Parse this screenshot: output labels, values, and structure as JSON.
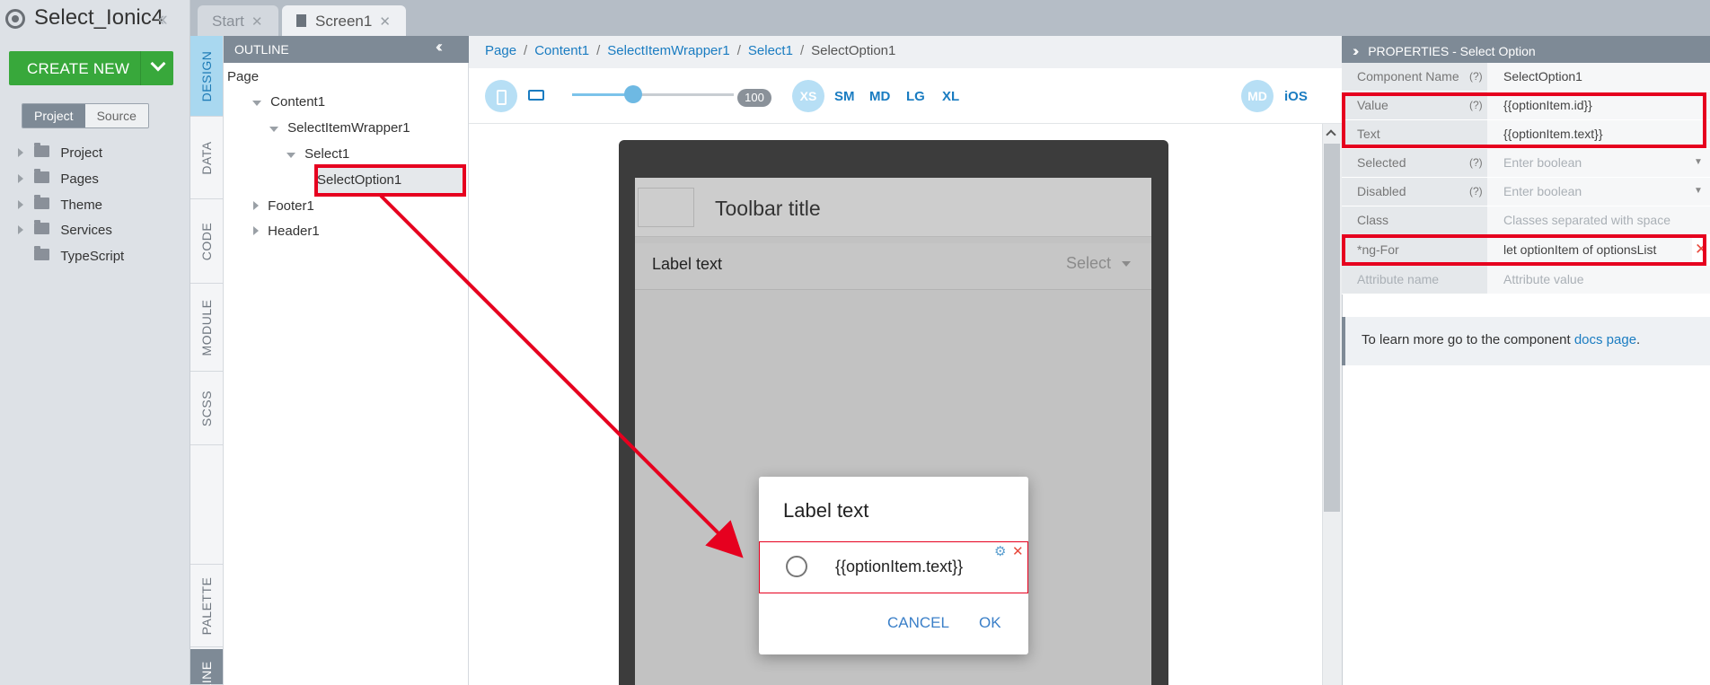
{
  "app": {
    "title": "Select_Ionic4",
    "create_new": "CREATE NEW",
    "toggle": [
      "Project",
      "Source"
    ],
    "tree": [
      {
        "label": "Project",
        "expandable": true
      },
      {
        "label": "Pages",
        "expandable": true
      },
      {
        "label": "Theme",
        "expandable": true
      },
      {
        "label": "Services",
        "expandable": true
      },
      {
        "label": "TypeScript",
        "expandable": false
      }
    ]
  },
  "tabs": [
    {
      "label": "Start"
    },
    {
      "label": "Screen1"
    }
  ],
  "vertical_tabs": [
    "DESIGN",
    "DATA",
    "CODE",
    "MODULE",
    "SCSS",
    "PALETTE",
    "LINE"
  ],
  "outline": {
    "title": "OUTLINE",
    "nodes": [
      "Page",
      "Content1",
      "SelectItemWrapper1",
      "Select1",
      "SelectOption1",
      "Footer1",
      "Header1"
    ]
  },
  "breadcrumb": [
    "Page",
    "Content1",
    "SelectItemWrapper1",
    "Select1",
    "SelectOption1"
  ],
  "device_bar": {
    "zoom": "100",
    "zoom_fraction": 0.38,
    "breakpoints": [
      "XS",
      "SM",
      "MD",
      "LG",
      "XL"
    ],
    "platforms": [
      "MD",
      "iOS"
    ]
  },
  "preview": {
    "toolbar_title": "Toolbar title",
    "select_label": "Label text",
    "select_value": "Select",
    "dialog": {
      "title": "Label text",
      "option_text": "{{optionItem.text}}",
      "cancel": "CANCEL",
      "ok": "OK"
    }
  },
  "properties": {
    "title": "PROPERTIES - Select Option",
    "rows": [
      {
        "key": "Component Name",
        "help": "(?)",
        "value": "SelectOption1",
        "placeholder": false
      },
      {
        "key": "Value",
        "help": "(?)",
        "value": "{{optionItem.id}}",
        "placeholder": false
      },
      {
        "key": "Text",
        "help": "",
        "value": "{{optionItem.text}}",
        "placeholder": false
      },
      {
        "key": "Selected",
        "help": "(?)",
        "value": "Enter boolean",
        "placeholder": true,
        "dropdown": true
      },
      {
        "key": "Disabled",
        "help": "(?)",
        "value": "Enter boolean",
        "placeholder": true,
        "dropdown": true
      },
      {
        "key": "Class",
        "help": "",
        "value": "Classes separated with space",
        "placeholder": true
      },
      {
        "key": "*ng-For",
        "help": "",
        "value": "let optionItem of optionsList",
        "placeholder": false,
        "removable": true
      },
      {
        "key": "Attribute name",
        "help": "",
        "value": "Attribute value",
        "placeholder": true
      }
    ],
    "docs_text": "To learn more go to the component",
    "docs_link": "docs page",
    "docs_end": "."
  },
  "colors": {
    "accent": "#1a7cc1",
    "create_button": "#38a83b",
    "annotation": "#e6001f",
    "panel_header": "#7e8a96"
  }
}
